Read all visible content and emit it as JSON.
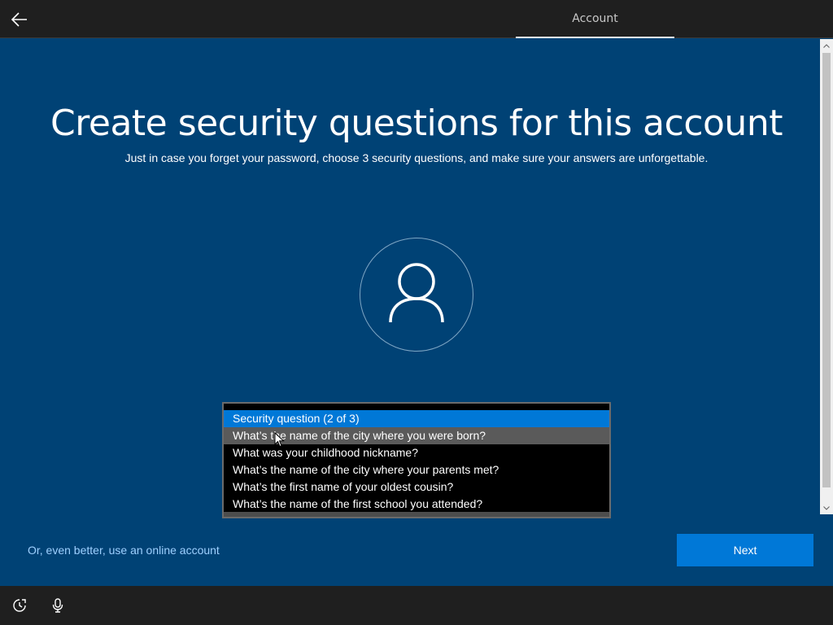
{
  "header": {
    "back_icon": "arrow-left-icon",
    "tab_label": "Account"
  },
  "main": {
    "title": "Create security questions for this account",
    "subtitle": "Just in case you forget your password, choose 3 security questions, and make sure your answers are unforgettable.",
    "avatar_icon": "user-icon"
  },
  "dropdown": {
    "items": [
      {
        "label": "Security question (2 of 3)",
        "state": "selected"
      },
      {
        "label": "What’s the name of the city where you were born?",
        "state": "hover"
      },
      {
        "label": "What was your childhood nickname?",
        "state": "normal"
      },
      {
        "label": "What’s the name of the city where your parents met?",
        "state": "normal"
      },
      {
        "label": "What’s the first name of your oldest cousin?",
        "state": "normal"
      },
      {
        "label": "What’s the name of the first school you attended?",
        "state": "normal"
      }
    ]
  },
  "footer": {
    "online_account_link": "Or, even better, use an online account",
    "next_label": "Next"
  },
  "taskbar": {
    "icons": [
      "ease-of-access-icon",
      "microphone-icon"
    ]
  },
  "colors": {
    "background": "#004275",
    "accent": "#0078d7",
    "link": "#9ed0ff",
    "bar": "#1f1f1f"
  }
}
